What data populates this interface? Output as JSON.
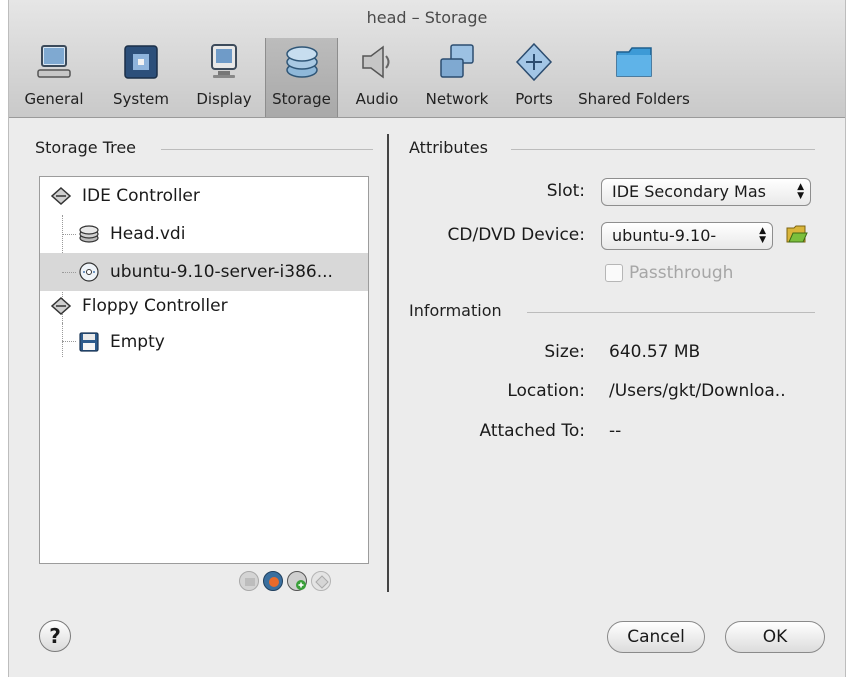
{
  "window": {
    "title": "head – Storage"
  },
  "toolbar": {
    "items": [
      {
        "label": "General",
        "icon": "monitor-icon"
      },
      {
        "label": "System",
        "icon": "chip-icon"
      },
      {
        "label": "Display",
        "icon": "display-icon"
      },
      {
        "label": "Storage",
        "icon": "disk-stack-icon",
        "active": true
      },
      {
        "label": "Audio",
        "icon": "speaker-icon"
      },
      {
        "label": "Network",
        "icon": "network-icon"
      },
      {
        "label": "Ports",
        "icon": "ports-icon"
      },
      {
        "label": "Shared Folders",
        "icon": "folder-icon"
      }
    ]
  },
  "storage_tree": {
    "heading": "Storage Tree",
    "items": [
      {
        "label": "IDE Controller",
        "icon": "controller-icon",
        "level": 0
      },
      {
        "label": "Head.vdi",
        "icon": "hard-disk-icon",
        "level": 1
      },
      {
        "label": "ubuntu-9.10-server-i386...",
        "icon": "cd-dvd-icon",
        "level": 1,
        "selected": true
      },
      {
        "label": "Floppy Controller",
        "icon": "controller-icon",
        "level": 0
      },
      {
        "label": "Empty",
        "icon": "floppy-icon",
        "level": 1
      }
    ]
  },
  "attributes": {
    "heading": "Attributes",
    "slot_label": "Slot:",
    "slot_value": "IDE Secondary Mas",
    "device_label": "CD/DVD Device:",
    "device_value": "ubuntu-9.10-",
    "passthrough_label": "Passthrough"
  },
  "information": {
    "heading": "Information",
    "size_label": "Size:",
    "size_value": "640.57 MB",
    "location_label": "Location:",
    "location_value": "/Users/gkt/Downloa..",
    "attached_label": "Attached To:",
    "attached_value": "--"
  },
  "footer": {
    "help_label": "?",
    "cancel_label": "Cancel",
    "ok_label": "OK"
  },
  "colors": {
    "selection": "#d8d8d8",
    "toolbar_active": "#b1b1b1",
    "folder": "#3d9ad6",
    "add_green": "#3aa03a"
  }
}
